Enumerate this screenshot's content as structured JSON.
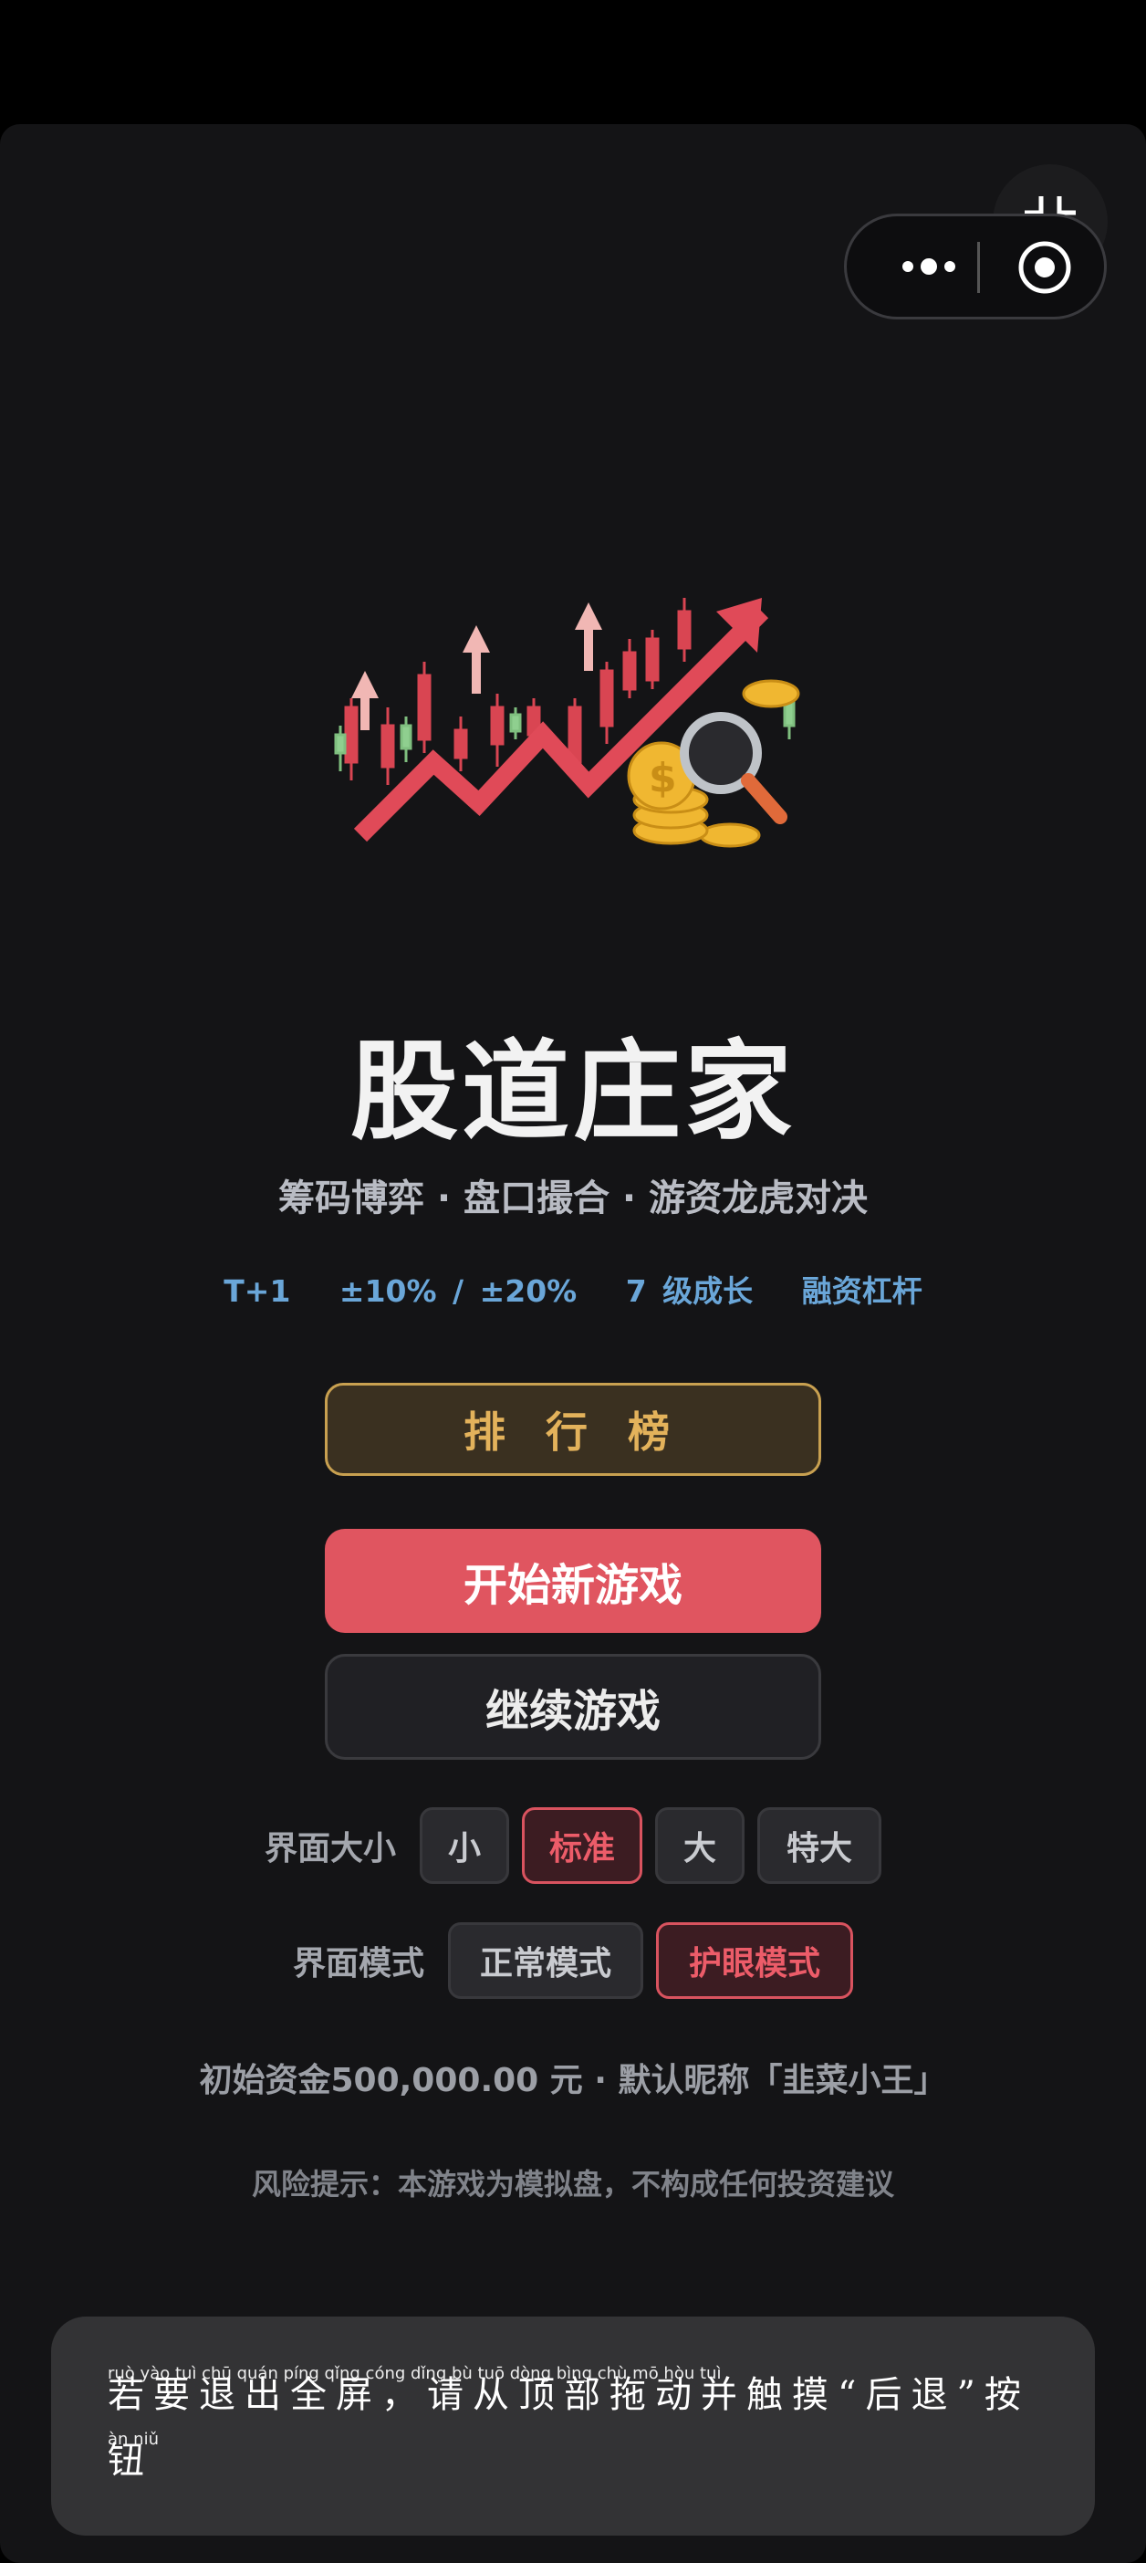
{
  "app": {
    "title": "股道庄家",
    "subtitle": "筹码博弈 · 盘口撮合 · 游资龙虎对决",
    "features": [
      "T+1",
      "±10% / ±20%",
      "7 级成长",
      "融资杠杆"
    ]
  },
  "buttons": {
    "leaderboard": "排 行 榜",
    "new_game": "开始新游戏",
    "continue_game": "继续游戏"
  },
  "ui_size": {
    "label": "界面大小",
    "options": [
      "小",
      "标准",
      "大",
      "特大"
    ],
    "selected": "标准"
  },
  "ui_mode": {
    "label": "界面模式",
    "options": [
      "正常模式",
      "护眼模式"
    ],
    "selected": "护眼模式"
  },
  "info": "初始资金500,000.00 元 · 默认昵称「韭菜小王」",
  "risk": "风险提示：本游戏为模拟盘，不构成任何投资建议",
  "toast": {
    "text": "若要退出全屏，请从顶部拖动并触摸“后退”按钮",
    "pinyin_line1": "ruò yào tuì chū quán píng   qǐng cóng dǐng bù tuō dòng bìng chù mō   hòu tuì",
    "pinyin_line2": "àn niǔ"
  },
  "colors": {
    "accent": "#e05560",
    "gold": "#e3b25b",
    "blue": "#6aa6d8",
    "background": "#141416"
  },
  "icons": [
    "more-dots-icon",
    "close-target-icon",
    "exit-fullscreen-icon",
    "stock-chart-logo"
  ]
}
